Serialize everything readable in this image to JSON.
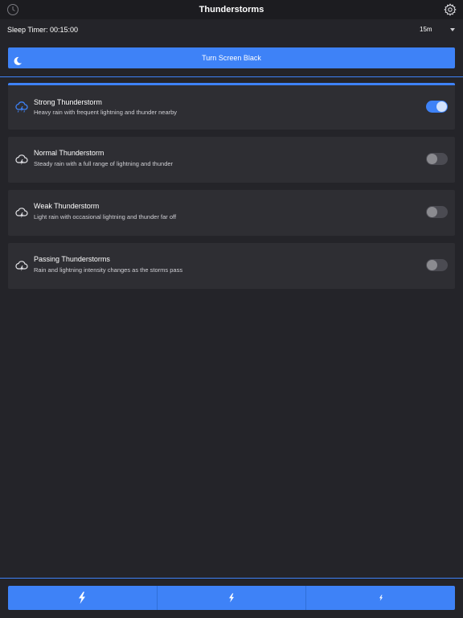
{
  "header": {
    "title": "Thunderstorms",
    "left_icon": "clock-icon",
    "right_icon": "gear-icon"
  },
  "sleep_timer": {
    "label": "Sleep Timer: 00:15:00",
    "selected": "15m"
  },
  "screen_button": {
    "label": "Turn Screen Black",
    "icon": "moon-icon"
  },
  "sounds": [
    {
      "name": "Strong Thunderstorm",
      "description": "Heavy rain with frequent lightning and thunder nearby",
      "enabled": true
    },
    {
      "name": "Normal Thunderstorm",
      "description": "Steady rain with a full range of lightning and thunder",
      "enabled": false
    },
    {
      "name": "Weak Thunderstorm",
      "description": "Light rain with occasional lightning and thunder far off",
      "enabled": false
    },
    {
      "name": "Passing Thunderstorms",
      "description": "Rain and lightning intensity changes as the storms pass",
      "enabled": false
    }
  ],
  "bottom_bar": {
    "buttons": [
      "lightning-large-icon",
      "lightning-medium-icon",
      "lightning-small-icon"
    ]
  },
  "colors": {
    "accent": "#3e82f7",
    "background": "#242429",
    "card": "#2e2e33",
    "topbar": "#1c1c20"
  }
}
